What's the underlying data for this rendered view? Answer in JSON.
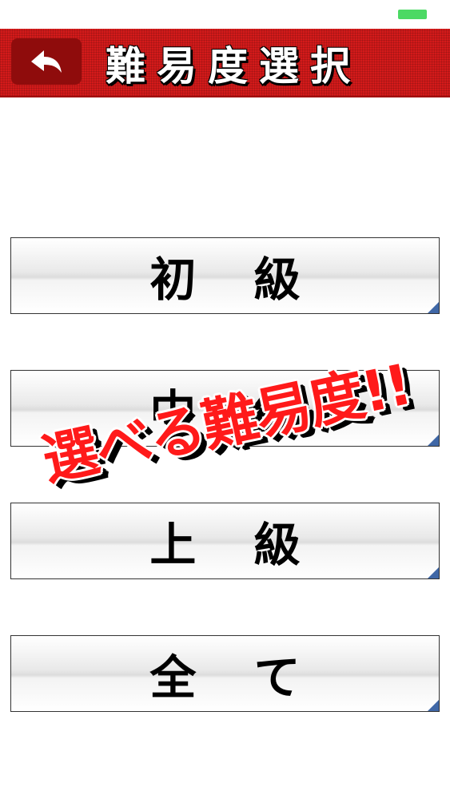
{
  "header": {
    "title": "難易度選択",
    "back_icon": "back-arrow-icon",
    "background_color": "#d41a1a"
  },
  "levels": [
    {
      "label": "初 級"
    },
    {
      "label": "中 級"
    },
    {
      "label": "上 級"
    },
    {
      "label": "全 て"
    }
  ],
  "promo": {
    "text": "選べる難易度!!",
    "color": "#ff1a1a"
  },
  "status": {
    "battery_color": "#4cd964"
  }
}
